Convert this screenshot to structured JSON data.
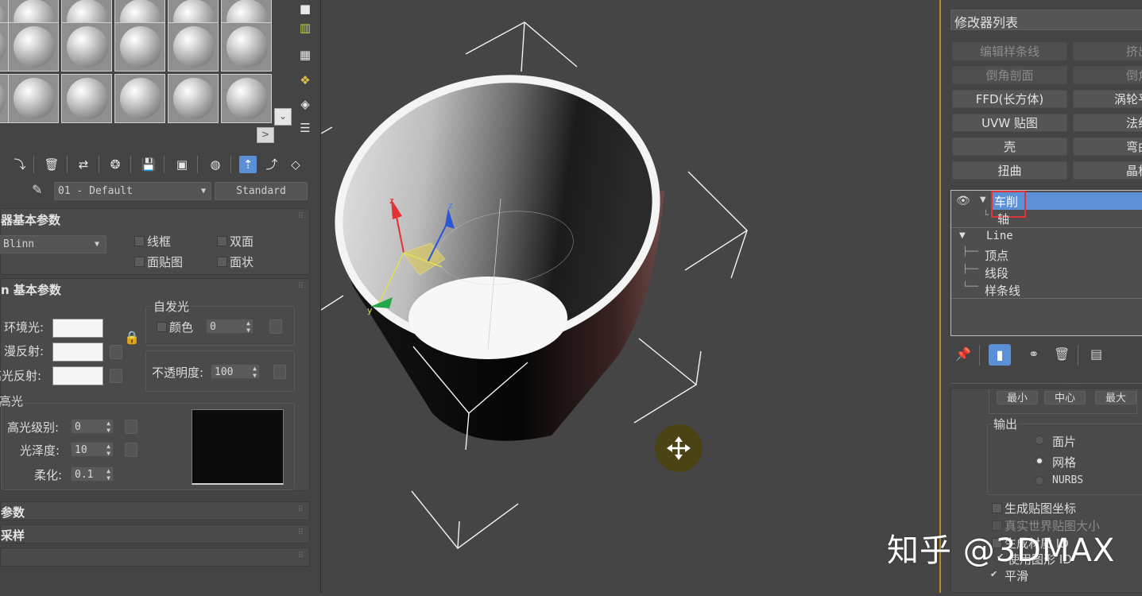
{
  "material_editor": {
    "nav_arrow": ">",
    "collapse_arrow": "⌄",
    "material_name": "01 - Default",
    "material_type": "Standard",
    "shader_rollout": {
      "title": "器基本参数",
      "shader": "Blinn",
      "wire": "线框",
      "two_sided": "双面",
      "face_map": "面贴图",
      "faceted": "面状"
    },
    "basic_rollout": {
      "title": "n 基本参数",
      "ambient": "环境光:",
      "diffuse": "漫反射:",
      "specular": "高光反射:",
      "self_illum_title": "自发光",
      "color_label": "颜色",
      "color_value": "0",
      "opacity_label": "不透明度:",
      "opacity_value": "100",
      "lock_icon": "lock-icon"
    },
    "highlight": {
      "title": "高光",
      "spec_level_label": "高光级别:",
      "spec_level_value": "0",
      "gloss_label": "光泽度:",
      "gloss_value": "10",
      "soften_label": "柔化:",
      "soften_value": "0.1"
    },
    "collapsed_rollouts": [
      "参数",
      "采样"
    ]
  },
  "command_panel": {
    "modifier_list_label": "修改器列表",
    "modifier_buttons": [
      {
        "left": "编辑样条线",
        "right": "挤出",
        "enabled": false
      },
      {
        "left": "倒角剖面",
        "right": "倒角",
        "enabled": false
      },
      {
        "left": "FFD(长方体)",
        "right": "涡轮平",
        "enabled": true
      },
      {
        "left": "UVW 贴图",
        "right": "法线",
        "enabled": true
      },
      {
        "left": "壳",
        "right": "弯曲",
        "enabled": true
      },
      {
        "left": "扭曲",
        "right": "晶格",
        "enabled": true
      }
    ],
    "stack": {
      "lathe": "车削",
      "axis": "轴",
      "line": "Line",
      "vertex": "顶点",
      "segment": "线段",
      "spline": "样条线"
    },
    "align_buttons": [
      "最小",
      "中心",
      "最大"
    ],
    "output": {
      "title": "输出",
      "patch": "面片",
      "mesh": "网格",
      "nurbs": "NURBS",
      "selected": "mesh"
    },
    "gen_map_coords": "生成贴图坐标",
    "real_world_map": "真实世界贴图大小",
    "gen_material_ids": "生成材质 ID",
    "use_shape_ids": "使用图形 ID",
    "smooth": "平滑"
  },
  "watermark": "知乎 @3DMAX",
  "colors": {
    "accent_blue": "#5b8fd6",
    "highlight_red": "#e0343c",
    "selected_row": "#5b8fd6"
  }
}
